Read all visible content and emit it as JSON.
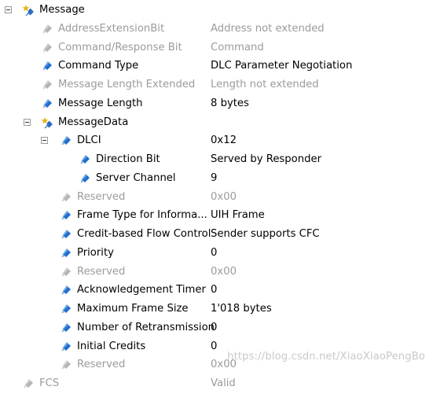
{
  "tree": {
    "rows": [
      {
        "name": "Message",
        "value": "",
        "level": 0,
        "kind": "message",
        "expandable": true,
        "muted": false
      },
      {
        "name": "AddressExtensionBit",
        "value": "Address not extended",
        "level": 1,
        "kind": "field",
        "expandable": false,
        "muted": true
      },
      {
        "name": "Command/Response Bit",
        "value": "Command",
        "level": 1,
        "kind": "field",
        "expandable": false,
        "muted": true
      },
      {
        "name": "Command Type",
        "value": "DLC Parameter Negotiation",
        "level": 1,
        "kind": "field",
        "expandable": false,
        "muted": false
      },
      {
        "name": "Message Length Extended",
        "value": "Length not extended",
        "level": 1,
        "kind": "field",
        "expandable": false,
        "muted": true
      },
      {
        "name": "Message Length",
        "value": "8 bytes",
        "level": 1,
        "kind": "field",
        "expandable": false,
        "muted": false
      },
      {
        "name": "MessageData",
        "value": "",
        "level": 1,
        "kind": "message",
        "expandable": true,
        "muted": false
      },
      {
        "name": "DLCI",
        "value": "0x12",
        "level": 2,
        "kind": "field",
        "expandable": true,
        "muted": false
      },
      {
        "name": "Direction Bit",
        "value": "Served by Responder",
        "level": 3,
        "kind": "field",
        "expandable": false,
        "muted": false
      },
      {
        "name": "Server Channel",
        "value": "9",
        "level": 3,
        "kind": "field",
        "expandable": false,
        "muted": false
      },
      {
        "name": "Reserved",
        "value": "0x00",
        "level": 2,
        "kind": "field",
        "expandable": false,
        "muted": true
      },
      {
        "name": "Frame Type for Informa...",
        "value": "UIH Frame",
        "level": 2,
        "kind": "field",
        "expandable": false,
        "muted": false
      },
      {
        "name": "Credit-based Flow Control",
        "value": "Sender supports CFC",
        "level": 2,
        "kind": "field",
        "expandable": false,
        "muted": false
      },
      {
        "name": "Priority",
        "value": "0",
        "level": 2,
        "kind": "field",
        "expandable": false,
        "muted": false
      },
      {
        "name": "Reserved",
        "value": "0x00",
        "level": 2,
        "kind": "field",
        "expandable": false,
        "muted": true
      },
      {
        "name": "Acknowledgement Timer",
        "value": "0",
        "level": 2,
        "kind": "field",
        "expandable": false,
        "muted": false
      },
      {
        "name": "Maximum Frame Size",
        "value": "1'018 bytes",
        "level": 2,
        "kind": "field",
        "expandable": false,
        "muted": false
      },
      {
        "name": "Number of Retransmission",
        "value": "0",
        "level": 2,
        "kind": "field",
        "expandable": false,
        "muted": false
      },
      {
        "name": "Initial Credits",
        "value": "0",
        "level": 2,
        "kind": "field",
        "expandable": false,
        "muted": false
      },
      {
        "name": "Reserved",
        "value": "0x00",
        "level": 2,
        "kind": "field",
        "expandable": false,
        "muted": true
      },
      {
        "name": "FCS",
        "value": "Valid",
        "level": 0,
        "kind": "field",
        "expandable": false,
        "muted": true
      }
    ]
  },
  "watermark": "https://blog.csdn.net/XiaoXiaoPengBo",
  "colors": {
    "active_text": "#000000",
    "muted_text": "#9b9b9b",
    "field_icon": "#1e6fd0",
    "field_icon_muted": "#b5b5b5",
    "message_icon_yellow": "#e8b416",
    "message_icon_blue": "#2a6dc4"
  },
  "icons": {
    "field": "field-diamond-icon",
    "message": "message-struct-icon",
    "toggle": "collapse-toggle-icon"
  }
}
